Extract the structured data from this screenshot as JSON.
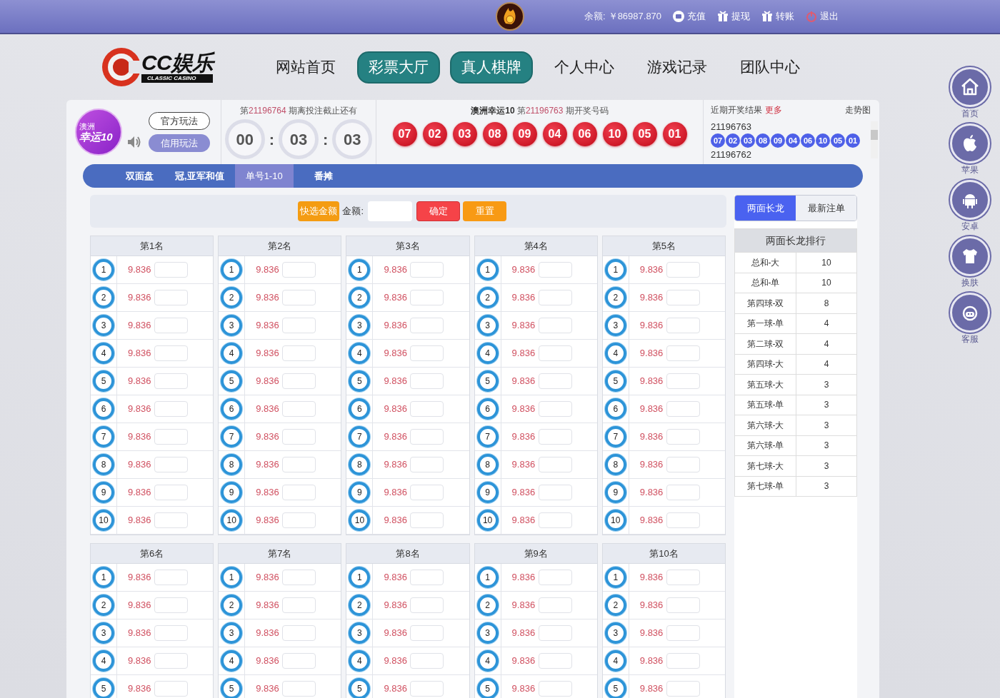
{
  "topbar": {
    "balance_label": "余额:",
    "balance": "￥86987.870",
    "links": [
      {
        "label": "充值",
        "kind": "recharge"
      },
      {
        "label": "提现",
        "kind": "withdraw"
      },
      {
        "label": "转账",
        "kind": "transfer"
      },
      {
        "label": "退出",
        "kind": "logout"
      }
    ]
  },
  "header": {
    "logo": {
      "name": "CC娱乐",
      "tagline": "CLASSIC CASINO"
    },
    "nav": [
      {
        "label": "网站首页",
        "highlighted": false
      },
      {
        "label": "彩票大厅",
        "highlighted": true
      },
      {
        "label": "真人棋牌",
        "highlighted": true
      },
      {
        "label": "个人中心",
        "highlighted": false
      },
      {
        "label": "游戏记录",
        "highlighted": false
      },
      {
        "label": "团队中心",
        "highlighted": false
      }
    ]
  },
  "game": {
    "badge_top": "澳洲",
    "badge_main": "幸运10",
    "modes": [
      {
        "label": "官方玩法",
        "selected": false
      },
      {
        "label": "信用玩法",
        "selected": true
      }
    ]
  },
  "countdown": {
    "prefix": "第",
    "issue": "21196764",
    "suffix": " 期离投注截止还有",
    "digits": [
      "00",
      "03",
      "03"
    ],
    "separators": [
      ":",
      ":"
    ]
  },
  "draw": {
    "name": "澳洲幸运10",
    "prefix": " 第",
    "issue": "21196763",
    "suffix": " 期开奖号码",
    "numbers": [
      "07",
      "02",
      "03",
      "08",
      "09",
      "04",
      "06",
      "10",
      "05",
      "01"
    ]
  },
  "recent": {
    "title": "近期开奖结果",
    "more": "更多",
    "trend": "走势图",
    "entries": [
      {
        "issue": "21196763",
        "numbers": [
          "07",
          "02",
          "03",
          "08",
          "09",
          "04",
          "06",
          "10",
          "05",
          "01"
        ]
      },
      {
        "issue": "21196762"
      }
    ]
  },
  "tabs": [
    {
      "label": "双面盘",
      "selected": false
    },
    {
      "label": "冠,亚军和值",
      "selected": false
    },
    {
      "label": "单号1-10",
      "selected": true
    },
    {
      "label": "番摊",
      "selected": false
    }
  ],
  "betbar": {
    "quick": "快选金额",
    "amount_label": "金额:",
    "confirm": "确定",
    "reset": "重置"
  },
  "groups": [
    {
      "title": "第1名",
      "rows": [
        {
          "ball": "1",
          "odds": "9.836"
        },
        {
          "ball": "2",
          "odds": "9.836"
        },
        {
          "ball": "3",
          "odds": "9.836"
        },
        {
          "ball": "4",
          "odds": "9.836"
        },
        {
          "ball": "5",
          "odds": "9.836"
        },
        {
          "ball": "6",
          "odds": "9.836"
        },
        {
          "ball": "7",
          "odds": "9.836"
        },
        {
          "ball": "8",
          "odds": "9.836"
        },
        {
          "ball": "9",
          "odds": "9.836"
        },
        {
          "ball": "10",
          "odds": "9.836"
        }
      ]
    },
    {
      "title": "第2名",
      "rows": [
        {
          "ball": "1",
          "odds": "9.836"
        },
        {
          "ball": "2",
          "odds": "9.836"
        },
        {
          "ball": "3",
          "odds": "9.836"
        },
        {
          "ball": "4",
          "odds": "9.836"
        },
        {
          "ball": "5",
          "odds": "9.836"
        },
        {
          "ball": "6",
          "odds": "9.836"
        },
        {
          "ball": "7",
          "odds": "9.836"
        },
        {
          "ball": "8",
          "odds": "9.836"
        },
        {
          "ball": "9",
          "odds": "9.836"
        },
        {
          "ball": "10",
          "odds": "9.836"
        }
      ]
    },
    {
      "title": "第3名",
      "rows": [
        {
          "ball": "1",
          "odds": "9.836"
        },
        {
          "ball": "2",
          "odds": "9.836"
        },
        {
          "ball": "3",
          "odds": "9.836"
        },
        {
          "ball": "4",
          "odds": "9.836"
        },
        {
          "ball": "5",
          "odds": "9.836"
        },
        {
          "ball": "6",
          "odds": "9.836"
        },
        {
          "ball": "7",
          "odds": "9.836"
        },
        {
          "ball": "8",
          "odds": "9.836"
        },
        {
          "ball": "9",
          "odds": "9.836"
        },
        {
          "ball": "10",
          "odds": "9.836"
        }
      ]
    },
    {
      "title": "第4名",
      "rows": [
        {
          "ball": "1",
          "odds": "9.836"
        },
        {
          "ball": "2",
          "odds": "9.836"
        },
        {
          "ball": "3",
          "odds": "9.836"
        },
        {
          "ball": "4",
          "odds": "9.836"
        },
        {
          "ball": "5",
          "odds": "9.836"
        },
        {
          "ball": "6",
          "odds": "9.836"
        },
        {
          "ball": "7",
          "odds": "9.836"
        },
        {
          "ball": "8",
          "odds": "9.836"
        },
        {
          "ball": "9",
          "odds": "9.836"
        },
        {
          "ball": "10",
          "odds": "9.836"
        }
      ]
    },
    {
      "title": "第5名",
      "rows": [
        {
          "ball": "1",
          "odds": "9.836"
        },
        {
          "ball": "2",
          "odds": "9.836"
        },
        {
          "ball": "3",
          "odds": "9.836"
        },
        {
          "ball": "4",
          "odds": "9.836"
        },
        {
          "ball": "5",
          "odds": "9.836"
        },
        {
          "ball": "6",
          "odds": "9.836"
        },
        {
          "ball": "7",
          "odds": "9.836"
        },
        {
          "ball": "8",
          "odds": "9.836"
        },
        {
          "ball": "9",
          "odds": "9.836"
        },
        {
          "ball": "10",
          "odds": "9.836"
        }
      ]
    },
    {
      "title": "第6名",
      "rows": [
        {
          "ball": "1",
          "odds": "9.836"
        },
        {
          "ball": "2",
          "odds": "9.836"
        },
        {
          "ball": "3",
          "odds": "9.836"
        },
        {
          "ball": "4",
          "odds": "9.836"
        },
        {
          "ball": "5",
          "odds": "9.836"
        }
      ]
    },
    {
      "title": "第7名",
      "rows": [
        {
          "ball": "1",
          "odds": "9.836"
        },
        {
          "ball": "2",
          "odds": "9.836"
        },
        {
          "ball": "3",
          "odds": "9.836"
        },
        {
          "ball": "4",
          "odds": "9.836"
        },
        {
          "ball": "5",
          "odds": "9.836"
        }
      ]
    },
    {
      "title": "第8名",
      "rows": [
        {
          "ball": "1",
          "odds": "9.836"
        },
        {
          "ball": "2",
          "odds": "9.836"
        },
        {
          "ball": "3",
          "odds": "9.836"
        },
        {
          "ball": "4",
          "odds": "9.836"
        },
        {
          "ball": "5",
          "odds": "9.836"
        }
      ]
    },
    {
      "title": "第9名",
      "rows": [
        {
          "ball": "1",
          "odds": "9.836"
        },
        {
          "ball": "2",
          "odds": "9.836"
        },
        {
          "ball": "3",
          "odds": "9.836"
        },
        {
          "ball": "4",
          "odds": "9.836"
        },
        {
          "ball": "5",
          "odds": "9.836"
        }
      ]
    },
    {
      "title": "第10名",
      "rows": [
        {
          "ball": "1",
          "odds": "9.836"
        },
        {
          "ball": "2",
          "odds": "9.836"
        },
        {
          "ball": "3",
          "odds": "9.836"
        },
        {
          "ball": "4",
          "odds": "9.836"
        },
        {
          "ball": "5",
          "odds": "9.836"
        }
      ]
    }
  ],
  "side_panel": {
    "tabs": [
      {
        "label": "两面长龙",
        "selected": true
      },
      {
        "label": "最新注单",
        "selected": false
      }
    ],
    "ranking_title": "两面长龙排行",
    "ranking": [
      {
        "label": "总和-大",
        "count": "10"
      },
      {
        "label": "总和-单",
        "count": "10"
      },
      {
        "label": "第四球-双",
        "count": "8"
      },
      {
        "label": "第一球-单",
        "count": "4"
      },
      {
        "label": "第二球-双",
        "count": "4"
      },
      {
        "label": "第四球-大",
        "count": "4"
      },
      {
        "label": "第五球-大",
        "count": "3"
      },
      {
        "label": "第五球-单",
        "count": "3"
      },
      {
        "label": "第六球-大",
        "count": "3"
      },
      {
        "label": "第六球-单",
        "count": "3"
      },
      {
        "label": "第七球-大",
        "count": "3"
      },
      {
        "label": "第七球-单",
        "count": "3"
      }
    ]
  },
  "floating_menu": [
    {
      "label": "首页",
      "kind": "home"
    },
    {
      "label": "苹果",
      "kind": "apple"
    },
    {
      "label": "安卓",
      "kind": "android"
    },
    {
      "label": "换肤",
      "kind": "skin"
    },
    {
      "label": "客服",
      "kind": "service"
    }
  ]
}
